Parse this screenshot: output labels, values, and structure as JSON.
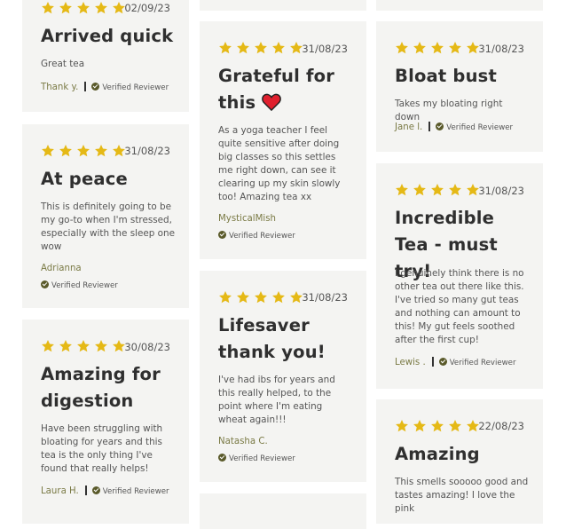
{
  "reviews": {
    "c1": [
      {
        "date": "02/09/23",
        "title": "Arrived quick",
        "body": "Great tea",
        "author": "Thank y.",
        "verified": "Verified Reviewer"
      },
      {
        "date": "31/08/23",
        "title": "At peace",
        "body": "This is definitely going to be my go-to when I'm stressed, especially with the sleep one wow",
        "author": "Adrianna",
        "verified": "Verified Reviewer"
      },
      {
        "date": "30/08/23",
        "title": "Amazing for digestion",
        "body": "Have been struggling with bloating for years and this tea is the only thing I've found that really helps!",
        "author": "Laura H.",
        "verified": "Verified Reviewer"
      }
    ],
    "c2": [
      {
        "date": "31/08/23",
        "title": "Grateful for this",
        "body": "As a yoga teacher I feel quite sensitive after doing big classes so this settles me right down, can see it clearing up my skin slowly too! Amazing tea xx",
        "author": "MysticalMish",
        "verified": "Verified Reviewer"
      },
      {
        "date": "31/08/23",
        "title": "Lifesaver thank you!",
        "body": "I've had ibs for years and this really helped, to the point where I'm eating wheat again!!!",
        "author": "Natasha C.",
        "verified": "Verified Reviewer"
      }
    ],
    "c3": [
      {
        "date": "31/08/23",
        "title": "Bloat bust",
        "body": "Takes my bloating right down",
        "author": "Jane l.",
        "verified": "Verified Reviewer"
      },
      {
        "date": "31/08/23",
        "title": "Incredible Tea - must try!",
        "body": "I genuinely think there is no other tea out there like this. I've tried so many gut teas and nothing can amount to this! My gut feels soothed after the first cup!",
        "author": "Lewis .",
        "verified": "Verified Reviewer"
      },
      {
        "date": "22/08/23",
        "title": "Amazing",
        "body": "This smells sooooo good and tastes amazing! I love the pink",
        "author": "",
        "verified": ""
      }
    ]
  },
  "rating": 5,
  "colors": {
    "star": "#e5b916",
    "card": "#f4f4f2",
    "author": "#7a7a45"
  }
}
